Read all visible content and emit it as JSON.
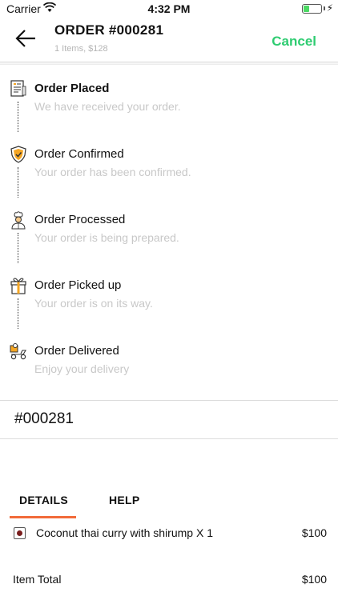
{
  "status": {
    "carrier": "Carrier",
    "time": "4:32 PM",
    "battery_level": 0.35
  },
  "header": {
    "title": "ORDER #000281",
    "subtitle": "1 Items, $128",
    "cancel_label": "Cancel"
  },
  "timeline": [
    {
      "title": "Order Placed",
      "desc": "We have received your order.",
      "icon": "receipt-icon",
      "active": true
    },
    {
      "title": "Order Confirmed",
      "desc": "Your order has been confirmed.",
      "icon": "shield-check-icon",
      "active": false
    },
    {
      "title": "Order Processed",
      "desc": "Your order is being prepared.",
      "icon": "chef-icon",
      "active": false
    },
    {
      "title": "Order Picked up",
      "desc": "Your order is on its way.",
      "icon": "gift-icon",
      "active": false
    },
    {
      "title": "Order Delivered",
      "desc": "Enjoy your delivery",
      "icon": "delivery-scooter-icon",
      "active": false
    }
  ],
  "order_number": "#000281",
  "tabs": [
    {
      "label": "DETAILS"
    },
    {
      "label": "HELP"
    }
  ],
  "items": [
    {
      "name": "Coconut thai curry with shirump X 1",
      "price": "$100"
    }
  ],
  "item_total": {
    "label": "Item Total",
    "value": "$100"
  },
  "colors": {
    "accent_green": "#2ecc71",
    "tab_indicator": "#f26b3a"
  }
}
